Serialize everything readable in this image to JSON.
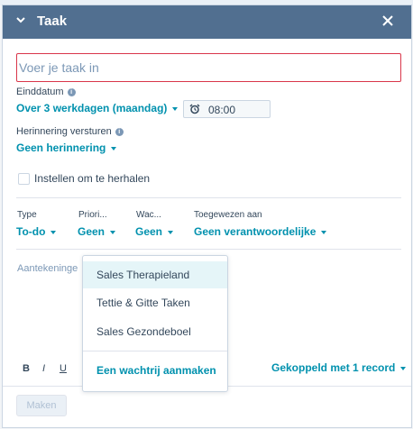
{
  "header": {
    "title": "Taak"
  },
  "task_input": {
    "placeholder": "Voer je taak in",
    "value": ""
  },
  "due": {
    "label": "Einddatum",
    "value": "Over 3 werkdagen (maandag)",
    "time": "08:00"
  },
  "reminder": {
    "label": "Herinnering versturen",
    "value": "Geen herinnering"
  },
  "repeat": {
    "label": "Instellen om te herhalen",
    "checked": false
  },
  "fields": {
    "type": {
      "label": "Type",
      "value": "To-do"
    },
    "priority": {
      "label": "Priori...",
      "value": "Geen"
    },
    "queue": {
      "label": "Wac...",
      "value": "Geen"
    },
    "assigned": {
      "label": "Toegewezen aan",
      "value": "Geen verantwoordelijke"
    }
  },
  "notes": {
    "placeholder": "Aantekeninge"
  },
  "format_toolbar": {
    "bold": "B",
    "italic": "I",
    "underline": "U"
  },
  "linked": "Gekoppeld met 1 record",
  "create_button": "Maken",
  "queue_dropdown": {
    "options": [
      "Sales Therapieland",
      "Tettie & Gitte Taken",
      "Sales Gezondeboel"
    ],
    "selected_index": 0,
    "action": "Een wachtrij aanmaken"
  },
  "colors": {
    "header_bg": "#516f90",
    "link": "#0091ae",
    "error_border": "#d9364a",
    "text": "#33475b"
  }
}
